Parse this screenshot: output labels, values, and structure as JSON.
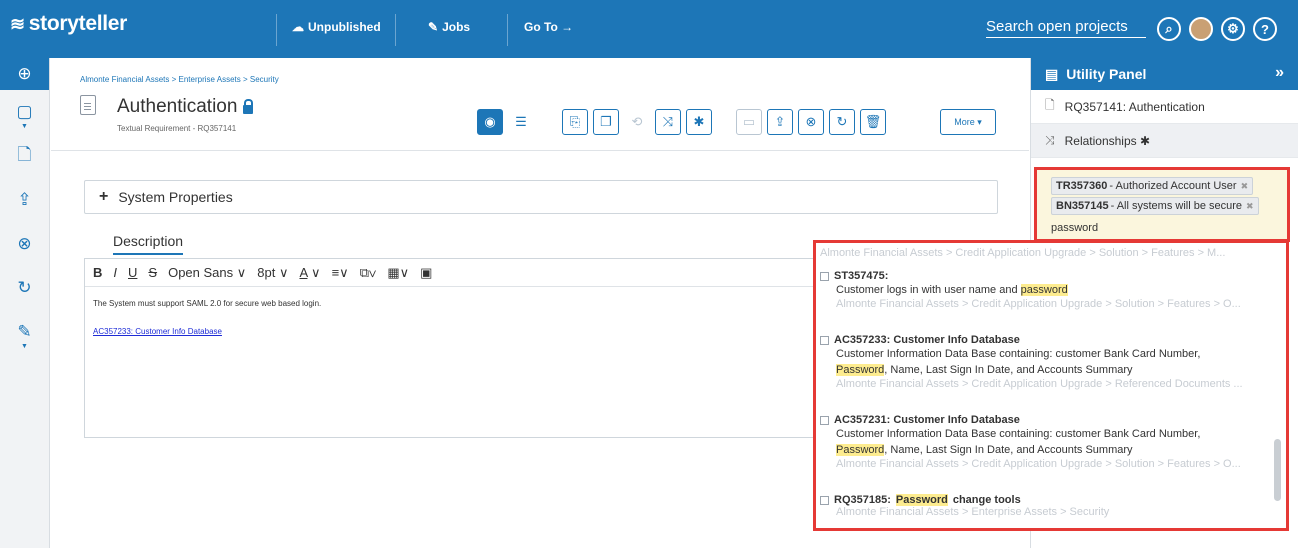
{
  "app": {
    "logo_text": "storyteller",
    "nav": {
      "unpublished": "Unpublished",
      "jobs": "Jobs",
      "goto": "Go To →"
    },
    "search_label": "Search open projects",
    "icons": {
      "help": "?"
    }
  },
  "artifact": {
    "breadcrumb": "Almonte Financial Assets > Enterprise Assets > Security",
    "title": "Authentication",
    "subtitle": "Textual Requirement - RQ357141",
    "more_label": "More ▾",
    "system_properties": "System Properties",
    "description_tab": "Description",
    "editor": {
      "font_name": "Open Sans ∨",
      "font_size": "8pt",
      "text": "The System must support SAML 2.0 for secure web based login.",
      "link": "AC357233: Customer Info Database"
    }
  },
  "utility_panel": {
    "title": "Utility Panel",
    "artifact_row": "RQ357141: Authentication",
    "relationships_label": "Relationships ✱",
    "chips": [
      {
        "id": "TR357360",
        "text": " - Authorized Account User"
      },
      {
        "id": "BN357145",
        "text": " - All systems will be secure"
      }
    ],
    "search_value": "password"
  },
  "results": [
    {
      "type": "path",
      "text": "Almonte Financial Assets > Credit Application Upgrade > Solution > Features > M..."
    },
    {
      "type": "item",
      "title": "ST357475:",
      "body_pre": "Customer logs in with user name and ",
      "body_hl": "password",
      "body_post": "",
      "path": "Almonte Financial Assets > Credit Application Upgrade > Solution > Features > O..."
    },
    {
      "type": "item",
      "title": "AC357233: Customer Info Database",
      "body_line1": "Customer Information Data Base containing: customer Bank Card Number,",
      "body_hl": "Password",
      "body_post": ", Name, Last Sign In Date, and Accounts Summary",
      "path": "Almonte Financial Assets > Credit Application Upgrade > Referenced Documents ..."
    },
    {
      "type": "item",
      "title": "AC357231: Customer Info Database",
      "body_line1": "Customer Information Data Base containing: customer Bank Card Number,",
      "body_hl": "Password",
      "body_post": ", Name, Last Sign In Date, and Accounts Summary",
      "path": "Almonte Financial Assets > Credit Application Upgrade > Solution > Features > O..."
    },
    {
      "type": "item",
      "title_pre": "RQ357185: ",
      "title_hl": "Password",
      "title_post": " change tools",
      "path": "Almonte Financial Assets > Enterprise Assets > Security"
    }
  ]
}
